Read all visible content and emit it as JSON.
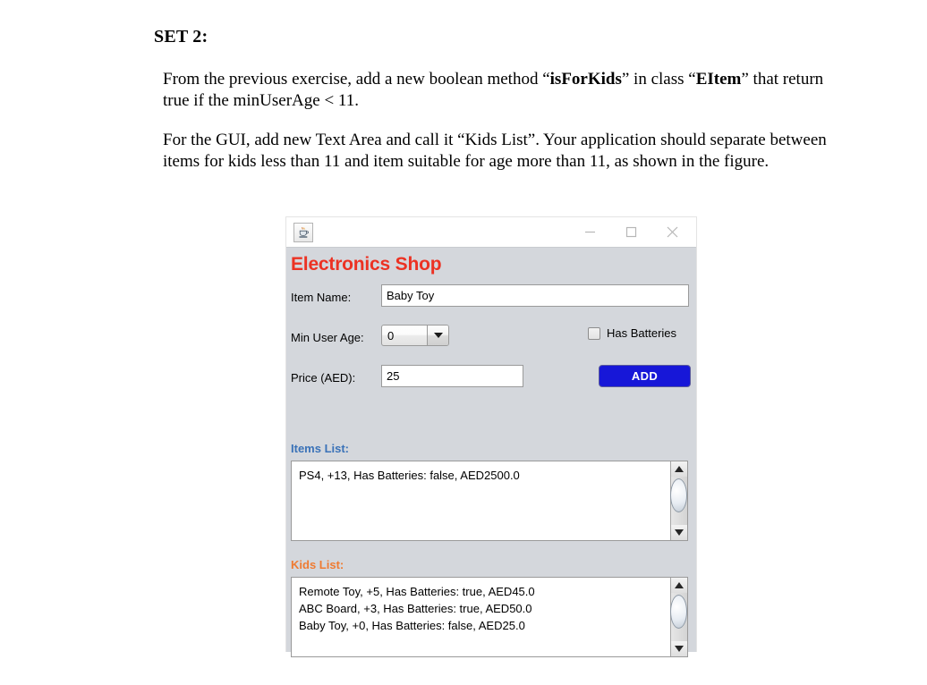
{
  "document": {
    "heading": "SET 2:",
    "paragraph_1_prefix": "From the previous exercise, add a new boolean method “",
    "paragraph_1_bold_1": "isForKids",
    "paragraph_1_mid": "” in class “",
    "paragraph_1_bold_2": "EItem",
    "paragraph_1_suffix": "” that return true if the  minUserAge < 11.",
    "paragraph_2": "For the GUI, add new Text Area and call it “Kids List”. Your application should separate between items for kids less than 11 and item suitable for age more than 11, as shown in the figure."
  },
  "window": {
    "app_icon": "java-coffee-cup-icon",
    "minimize_label": "minimize-icon",
    "maximize_label": "maximize-icon",
    "close_label": "close-icon",
    "title": "Electronics Shop",
    "title_color": "#ec3223",
    "panel_color": "#d4d7dc",
    "form": {
      "item_name_label": "Item Name:",
      "item_name_value": "Baby Toy",
      "min_user_age_label": "Min User Age:",
      "min_user_age_value": "0",
      "min_user_age_options": [
        "0"
      ],
      "has_batteries_label": "Has Batteries",
      "has_batteries_checked": false,
      "price_label": "Price (AED):",
      "price_value": "25",
      "add_button_label": "ADD",
      "add_button_color": "#1717d8"
    },
    "items_list": {
      "label": "Items List:",
      "label_color": "#3a72b8",
      "lines": [
        "PS4, +13, Has Batteries: false, AED2500.0"
      ],
      "text": "PS4, +13, Has Batteries: false, AED2500.0"
    },
    "kids_list": {
      "label": "Kids List:",
      "label_color": "#ef7b32",
      "lines": [
        "Remote Toy, +5, Has Batteries: true, AED45.0",
        "ABC Board, +3, Has Batteries: true, AED50.0",
        "Baby Toy, +0, Has Batteries: false, AED25.0"
      ],
      "text": "Remote Toy, +5, Has Batteries: true, AED45.0\nABC Board, +3, Has Batteries: true, AED50.0\nBaby Toy, +0, Has Batteries: false, AED25.0"
    }
  }
}
